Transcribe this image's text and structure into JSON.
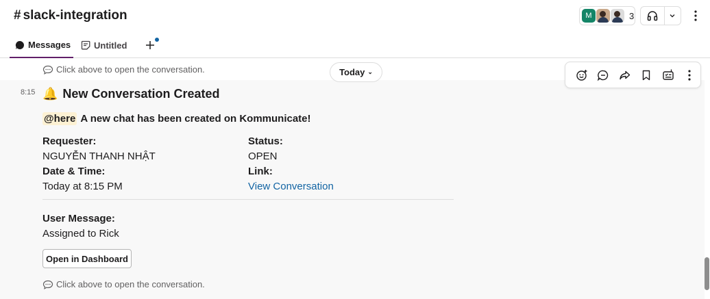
{
  "header": {
    "hash": "#",
    "channel_name": "slack-integration",
    "avatar_initial": "M",
    "member_count": "3"
  },
  "tabs": [
    {
      "label": "Messages",
      "icon": "message-bubble-icon",
      "active": true
    },
    {
      "label": "Untitled",
      "icon": "canvas-icon",
      "active": false
    }
  ],
  "date_divider": {
    "label": "Today"
  },
  "hint_text": "Click above to open the conversation.",
  "message": {
    "time": "8:15",
    "title_emoji": "🔔",
    "title": "New Conversation Created",
    "mention": "@here",
    "intro": "A new chat has been created on Kommunicate!",
    "fields": {
      "requester_label": "Requester:",
      "requester_value": "NGUYỄN THANH NHẬT",
      "status_label": "Status:",
      "status_value": "OPEN",
      "datetime_label": "Date & Time:",
      "datetime_value": "Today at 8:15 PM",
      "link_label": "Link:",
      "link_value": "View Conversation",
      "user_message_label": "User Message:",
      "user_message_value": "Assigned to Rick"
    },
    "button_label": "Open in Dashboard"
  },
  "colors": {
    "accent": "#611f69",
    "link": "#1264a3",
    "mention_bg": "#fdf1d3",
    "hover_bg": "#f8f8f8"
  }
}
